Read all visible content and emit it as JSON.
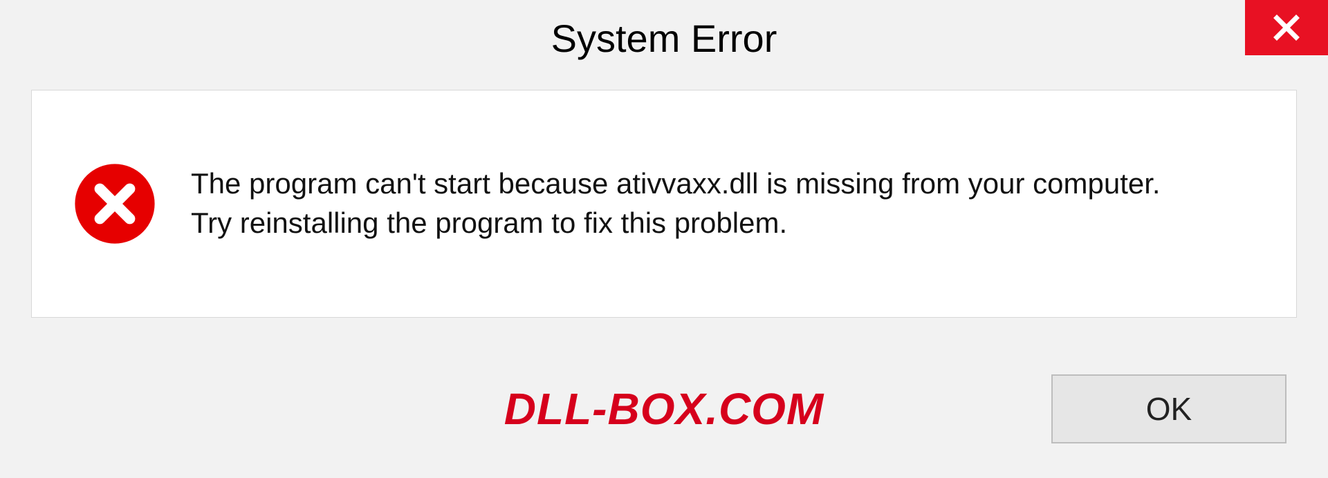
{
  "dialog": {
    "title": "System Error",
    "message_line1": "The program can't start because ativvaxx.dll is missing from your computer.",
    "message_line2": "Try reinstalling the program to fix this problem.",
    "ok_label": "OK"
  },
  "watermark": "DLL-BOX.COM",
  "colors": {
    "close_red": "#e81123",
    "error_red": "#e60000",
    "watermark_red": "#d6001c"
  }
}
